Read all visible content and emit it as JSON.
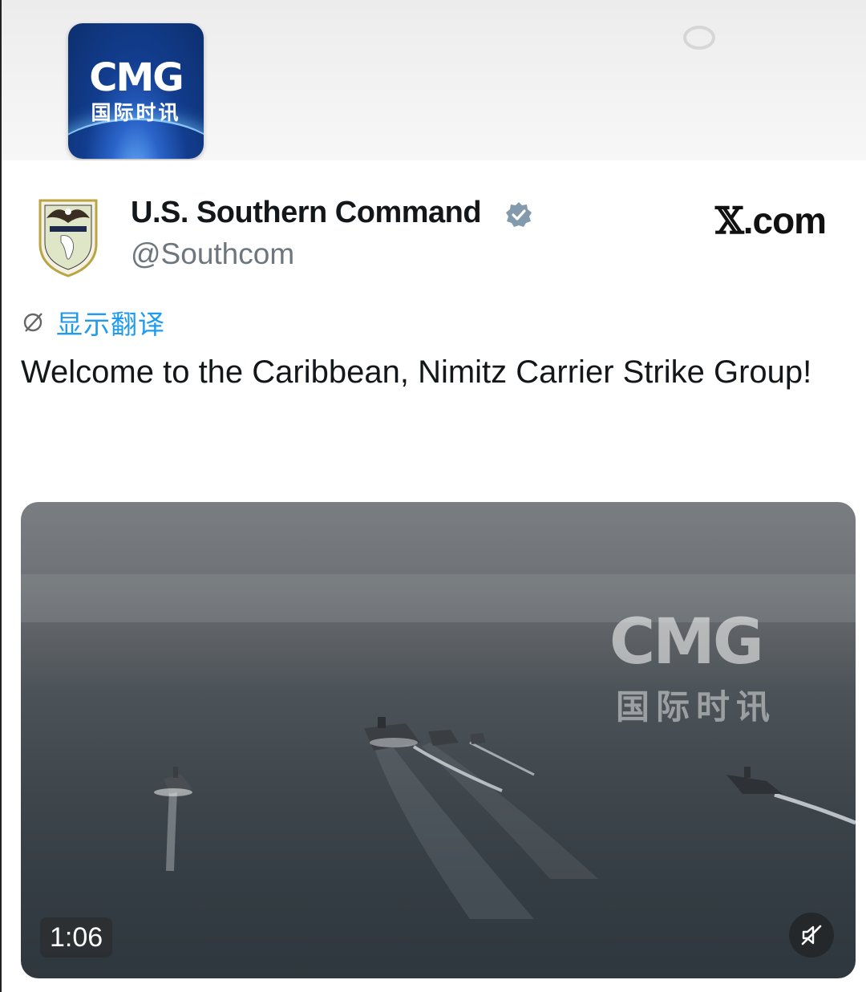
{
  "banner": {
    "logo_brand": "CMG",
    "logo_sub": "国际时讯"
  },
  "tweet": {
    "display_name": "U.S. Southern Command",
    "handle": "@Southcom",
    "source_site_mark": "𝕏",
    "source_site_suffix": ".com",
    "translate_label": "显示翻译",
    "text": "Welcome to the Caribbean, Nimitz Carrier Strike Group!"
  },
  "video": {
    "watermark_brand": "CMG",
    "watermark_sub": "国际时讯",
    "duration": "1:06",
    "muted": true
  },
  "colors": {
    "link_blue": "#1d9bf0",
    "handle_gray": "#6e767d",
    "verified_gray": "#829aab"
  },
  "icons": [
    "globe-icon",
    "verified-badge-icon",
    "muted-speaker-icon"
  ]
}
